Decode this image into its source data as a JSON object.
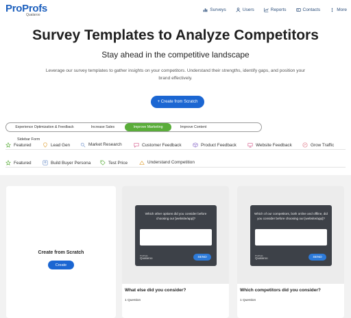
{
  "brand": {
    "name_a": "Pro",
    "name_b": "Profs",
    "sub": "Qualaroo"
  },
  "nav": [
    {
      "label": "Surveys",
      "icon": "chart-icon"
    },
    {
      "label": "Users",
      "icon": "user-icon"
    },
    {
      "label": "Reports",
      "icon": "bar-chart-icon"
    },
    {
      "label": "Contacts",
      "icon": "contact-icon"
    },
    {
      "label": "More",
      "icon": "more-icon"
    }
  ],
  "hero": {
    "title": "Survey Templates to Analyze Competitors",
    "subtitle": "Stay ahead in the competitive landscape",
    "description": "Leverage our survey templates to gather insights on your competitors. Understand their strengths, identify gaps, and position your brand effectively.",
    "cta": "+ Create from Scratch"
  },
  "categories": [
    {
      "label": "Experience Optimization & Feedback",
      "active": false
    },
    {
      "label": "Increase Sales",
      "active": false
    },
    {
      "label": "Improve Marketing",
      "active": true
    },
    {
      "label": "Improve Content",
      "active": false
    }
  ],
  "tabs_row1": {
    "overlay_label": "Sidebar Form",
    "items": [
      {
        "label": "Featured",
        "icon": "star-icon"
      },
      {
        "label": "Lead Gen",
        "icon": "location-pin-icon"
      },
      {
        "label": "Market Research",
        "icon": "search-icon"
      },
      {
        "label": "Customer Feedback",
        "icon": "chat-bubble-icon"
      },
      {
        "label": "Product Feedback",
        "icon": "box-icon"
      },
      {
        "label": "Website Feedback",
        "icon": "monitor-icon"
      },
      {
        "label": "Grow Traffic",
        "icon": "trend-icon"
      }
    ]
  },
  "tabs_row2": {
    "items": [
      {
        "label": "Featured",
        "icon": "star-icon"
      },
      {
        "label": "Build Buyer Persona",
        "icon": "persona-icon"
      },
      {
        "label": "Test Price",
        "icon": "price-tag-icon"
      },
      {
        "label": "Understand Competition",
        "icon": "people-icon"
      }
    ]
  },
  "scratch_card": {
    "title": "Create from Scratch",
    "button": "Create"
  },
  "templates": [
    {
      "question": "Which other options did you consider before choosing our [website/app]?",
      "send": "SEND",
      "powered_a": "ProProfs",
      "powered_b": "Qualaroo",
      "title": "What else did you consider?",
      "meta": "1 Question"
    },
    {
      "question": "Which of our competitors, both online and offline, did you consider before choosing our [website/app]?",
      "send": "SEND",
      "powered_a": "ProProfs",
      "powered_b": "Qualaroo",
      "title": "Which competitors did you consider?",
      "meta": "1 Question"
    }
  ],
  "colors": {
    "brand_blue": "#1b66d2",
    "active_green": "#5aad3a",
    "preview_dark": "#3d4148"
  }
}
